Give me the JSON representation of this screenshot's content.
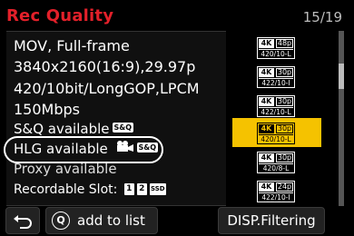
{
  "header": {
    "title": "Rec Quality",
    "page_indicator": "15/19"
  },
  "info": {
    "format_line": "MOV, Full-frame",
    "resolution_line": "3840x2160(16:9),29.97p",
    "codec_line": "420/10bit/LongGOP,LPCM",
    "bitrate_line": "150Mbps",
    "sq_label": "S&Q available",
    "sq_badge": "S&Q",
    "hlg_label": "HLG available",
    "hlg_badge": "S&Q",
    "hlg_icon": "movie-camera-icon",
    "proxy_label": "Proxy available",
    "slot_label": "Recordable Slot:",
    "slot_1": "1",
    "slot_2": "2",
    "slot_ssd": "SSD"
  },
  "format_list": [
    {
      "res": "4K",
      "fps": "48p",
      "codec": "420/10-L",
      "selected": false
    },
    {
      "res": "4K",
      "fps": "30p",
      "codec": "422/10-I",
      "selected": false
    },
    {
      "res": "4K",
      "fps": "30p",
      "codec": "422/10-L",
      "selected": false
    },
    {
      "res": "4K",
      "fps": "30p",
      "codec": "420/10-L",
      "selected": true
    },
    {
      "res": "4K",
      "fps": "30p",
      "codec": "420/8-L",
      "selected": false
    },
    {
      "res": "4K",
      "fps": "24p",
      "codec": "422/10-I",
      "selected": false
    }
  ],
  "footer": {
    "back_icon": "return-arrow-icon",
    "add_key": "Q",
    "add_label": "add to list",
    "disp_label": "DISP.Filtering"
  },
  "colors": {
    "title": "#e3202a",
    "selected": "#f5c200",
    "background": "#000000"
  }
}
